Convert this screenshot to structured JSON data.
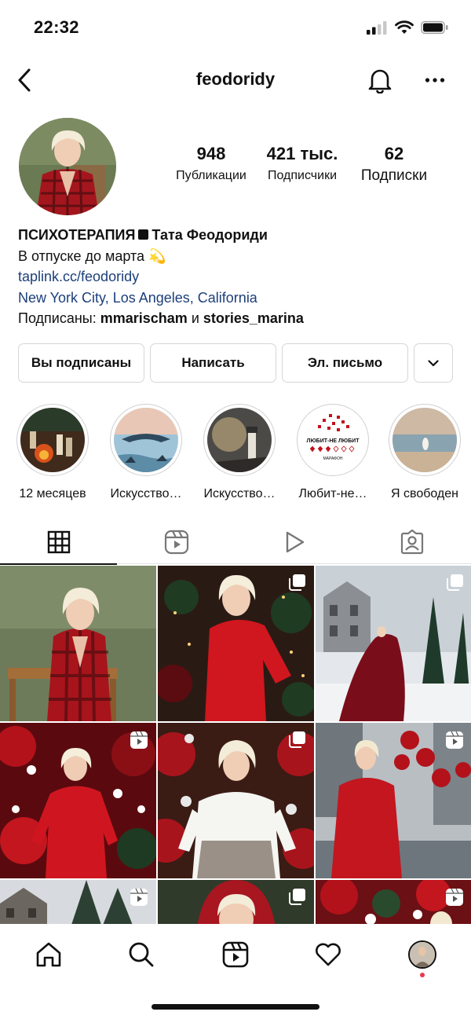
{
  "status_bar": {
    "time": "22:32"
  },
  "header": {
    "username": "feodoridy"
  },
  "profile": {
    "stats": [
      {
        "value": "948",
        "label": "Публикации"
      },
      {
        "value": "421 тыс.",
        "label": "Подписчики"
      },
      {
        "value": "62",
        "label": "Подписки"
      }
    ],
    "bio": {
      "name_part1": "ПСИХОТЕРАПИЯ",
      "name_part2": "Тата Феодориди",
      "status": "В отпуске до марта",
      "status_emoji": "💫",
      "link": "taplink.cc/feodoridy",
      "location": "New York City, Los Angeles, California",
      "followed_by_prefix": "Подписаны: ",
      "followed_by_user1": "mmarischam",
      "followed_by_sep": " и ",
      "followed_by_user2": "stories_marina"
    }
  },
  "actions": {
    "following": "Вы подписаны",
    "message": "Написать",
    "email": "Эл. письмо"
  },
  "highlights": [
    {
      "label": "12 месяцев"
    },
    {
      "label": "Искусство…"
    },
    {
      "label": "Искусство…"
    },
    {
      "label": "Любит-не…"
    },
    {
      "label": "Я свободен"
    }
  ],
  "highlight_art": {
    "line1": "ЛЮБИТ-НЕ ЛЮБИТ",
    "line2": "МАРАФОН"
  },
  "tabs": [
    "grid-icon",
    "reels-icon",
    "video-icon",
    "tagged-icon"
  ],
  "grid_badges": [
    "none",
    "carousel",
    "carousel",
    "reel",
    "carousel",
    "reel",
    "reel",
    "carousel",
    "reel"
  ],
  "bottom_nav": [
    "home-icon",
    "search-icon",
    "reels-icon",
    "heart-icon",
    "profile-avatar"
  ],
  "colors": {
    "link": "#1c3f7a",
    "accent_red": "#c0131c",
    "notification_dot": "#e8384f"
  }
}
